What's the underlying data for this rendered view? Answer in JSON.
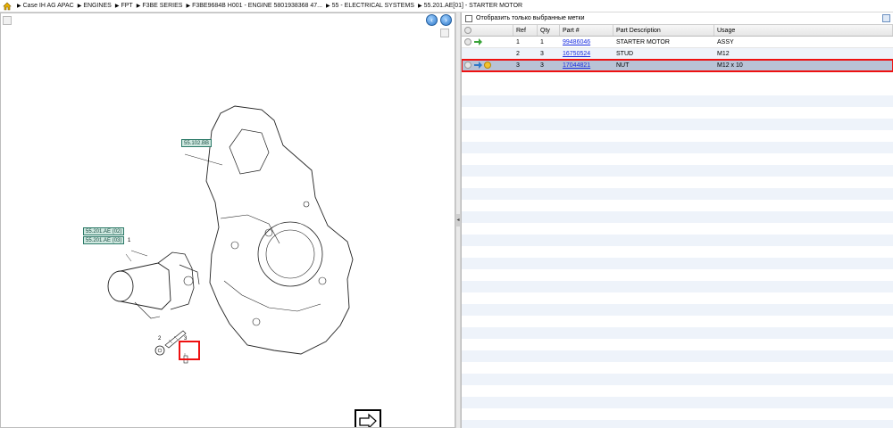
{
  "breadcrumb": {
    "items": [
      "Case IH AG APAC",
      "ENGINES",
      "FPT",
      "F3BE SERIES",
      "F3BE9684B H001 - ENGINE 5801938368 47...",
      "55 - ELECTRICAL SYSTEMS",
      "55.201.AE[01] - STARTER MOTOR"
    ]
  },
  "diagram": {
    "callouts": [
      "55.102.BB",
      "55.201.AE (02)",
      "55.201.AE (03)"
    ],
    "ref_numbers": [
      "1",
      "2",
      "3"
    ]
  },
  "filter": {
    "label": "Отобразить только выбранные метки"
  },
  "grid": {
    "headers": [
      "Ref",
      "Qty",
      "Part #",
      "Part Description",
      "Usage"
    ],
    "rows": [
      {
        "ref": "1",
        "qty": "1",
        "part": "99486046",
        "desc": "STARTER MOTOR",
        "usage": "ASSY"
      },
      {
        "ref": "2",
        "qty": "3",
        "part": "16750524",
        "desc": "STUD",
        "usage": "M12"
      },
      {
        "ref": "3",
        "qty": "3",
        "part": "17044821",
        "desc": "NUT",
        "usage": "M12 x 10"
      }
    ]
  },
  "colors": {
    "accent": "#2f78c8",
    "selection": "#b8c3d6",
    "highlight": "#ee1111",
    "link": "#1a2ee0"
  }
}
